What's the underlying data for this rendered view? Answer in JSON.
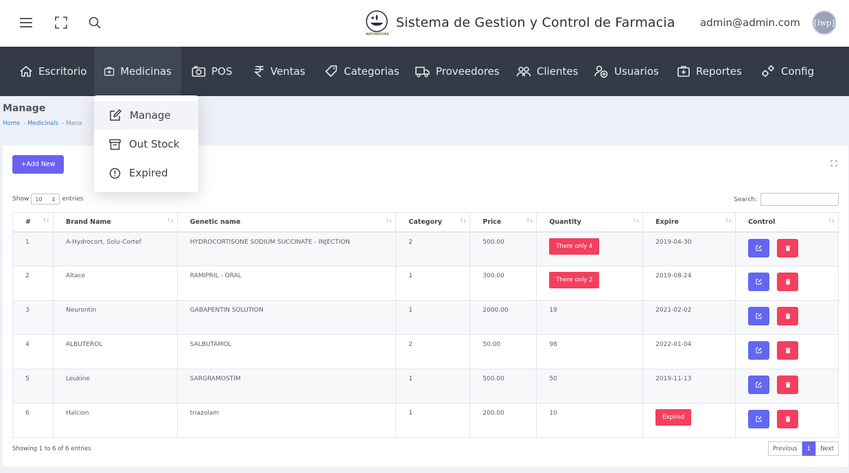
{
  "header": {
    "title": "Sistema de Gestion y Control de Farmacia",
    "user_email": "admin@admin.com",
    "avatar_text": "{lwp}",
    "logo_text": "NATUREPURE"
  },
  "nav": {
    "items": [
      {
        "label": "Escritorio",
        "icon": "home-icon"
      },
      {
        "label": "Medicinas",
        "icon": "medkit-icon"
      },
      {
        "label": "POS",
        "icon": "camera-icon"
      },
      {
        "label": "Ventas",
        "icon": "rupee-icon"
      },
      {
        "label": "Categorias",
        "icon": "tag-icon"
      },
      {
        "label": "Proveedores",
        "icon": "truck-icon"
      },
      {
        "label": "Clientes",
        "icon": "users-icon"
      },
      {
        "label": "Usuarios",
        "icon": "user-add-icon"
      },
      {
        "label": "Reportes",
        "icon": "report-icon"
      },
      {
        "label": "Config",
        "icon": "gears-icon"
      }
    ]
  },
  "dropdown": {
    "items": [
      {
        "label": "Manage",
        "icon": "edit-icon"
      },
      {
        "label": "Out Stock",
        "icon": "archive-icon"
      },
      {
        "label": "Expired",
        "icon": "alert-circle-icon"
      }
    ]
  },
  "page": {
    "title": "Manage",
    "breadcrumb": [
      "Home",
      "Medicinals",
      "Mana"
    ]
  },
  "card": {
    "add_button": "+Add New",
    "show_label": "Show",
    "entries_value": "10",
    "entries_label": "entries",
    "search_label": "Search:",
    "search_value": "",
    "info": "Showing 1 to 6 of 6 entries",
    "pager": {
      "prev": "Previous",
      "current": "1",
      "next": "Next"
    }
  },
  "table": {
    "columns": [
      "#",
      "Brand Name",
      "Genetic name",
      "Category",
      "Price",
      "Quantity",
      "Expire",
      "Control"
    ],
    "rows": [
      {
        "num": "1",
        "brand": "A-Hydrocort, Solu-Cortef",
        "generic": "HYDROCORTISONE SODIUM SUCCINATE - INJECTION",
        "category": "2",
        "price": "500.00",
        "quantity": "There only 4",
        "quantity_badge": true,
        "expire": "2019-04-30",
        "expire_badge": false
      },
      {
        "num": "2",
        "brand": "Altace",
        "generic": "RAMIPRIL - ORAL",
        "category": "1",
        "price": "300.00",
        "quantity": "There only 2",
        "quantity_badge": true,
        "expire": "2019-08-24",
        "expire_badge": false
      },
      {
        "num": "3",
        "brand": "Neurontin",
        "generic": "GABAPENTIN SOLUTION",
        "category": "1",
        "price": "2000.00",
        "quantity": "19",
        "quantity_badge": false,
        "expire": "2021-02-02",
        "expire_badge": false
      },
      {
        "num": "4",
        "brand": "ALBUTEROL",
        "generic": "SALBUTAMOL",
        "category": "2",
        "price": "50.00",
        "quantity": "98",
        "quantity_badge": false,
        "expire": "2022-01-04",
        "expire_badge": false
      },
      {
        "num": "5",
        "brand": "Leukine",
        "generic": "SARGRAMOSTIM",
        "category": "1",
        "price": "500.00",
        "quantity": "50",
        "quantity_badge": false,
        "expire": "2019-11-13",
        "expire_badge": false
      },
      {
        "num": "6",
        "brand": "Halcion",
        "generic": "triazolam",
        "category": "1",
        "price": "200.00",
        "quantity": "10",
        "quantity_badge": false,
        "expire": "Expired",
        "expire_badge": true
      }
    ]
  },
  "colors": {
    "nav_bg": "#343a46",
    "accent": "#6a62ee",
    "danger": "#f43f5e"
  }
}
